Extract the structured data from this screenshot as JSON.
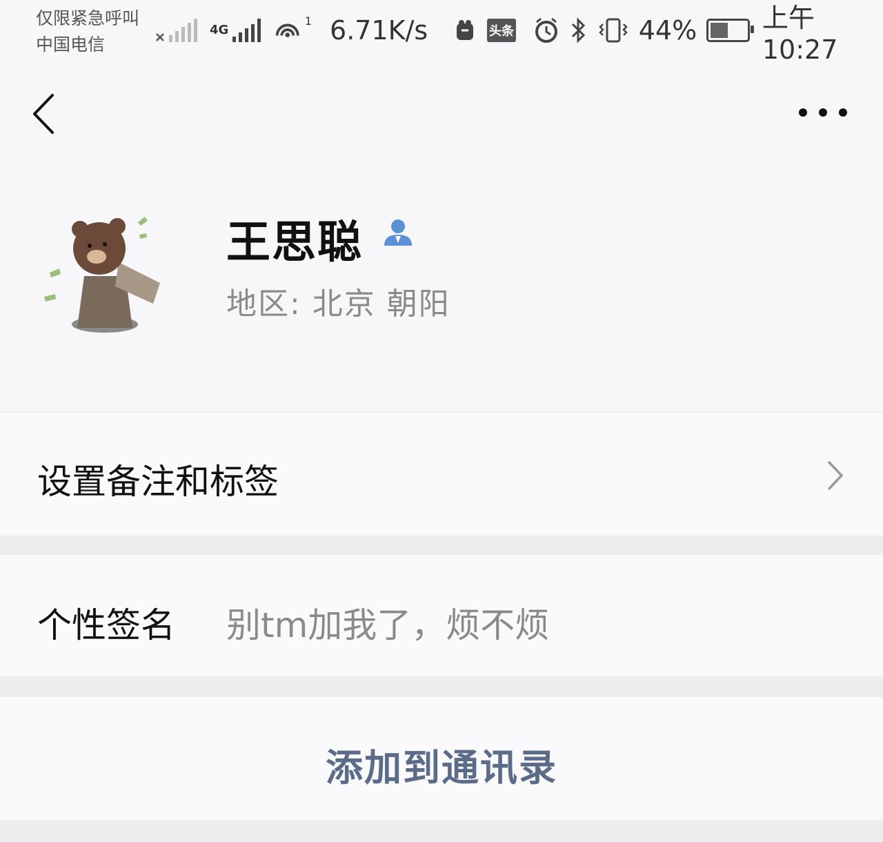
{
  "status_bar": {
    "emergency_text": "仅限紧急呼叫",
    "carrier": "中国电信",
    "network_label": "4G",
    "hotspot_count": "1",
    "speed": "6.71K/s",
    "toutiao_label": "头条",
    "battery_percent": "44%",
    "time": "上午10:27"
  },
  "nav": {
    "back_icon": "chevron-left-icon",
    "more_icon": "more-dots-icon"
  },
  "profile": {
    "name": "王思聪",
    "region": "地区: 北京  朝阳",
    "avatar_icon": "bear-avatar"
  },
  "menu": {
    "remark_tags_label": "设置备注和标签",
    "signature_label": "个性签名",
    "signature_value": "别tm加我了，烦不烦",
    "add_contact_label": "添加到通讯录"
  },
  "colors": {
    "background": "#f7f7f9",
    "link_text": "#5b6b8a",
    "secondary_text": "#8a8a8a"
  }
}
